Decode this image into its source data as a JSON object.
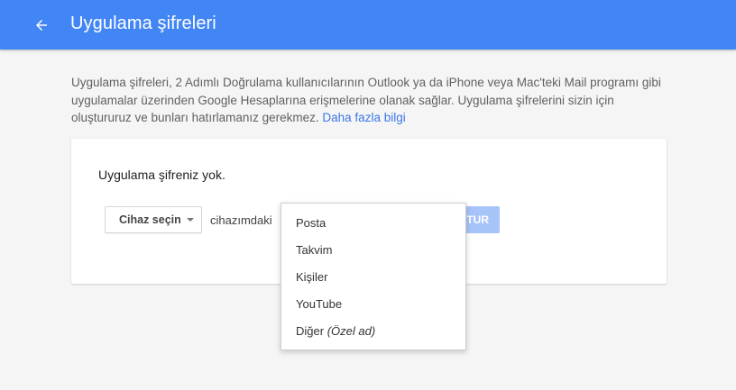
{
  "header": {
    "title": "Uygulama şifreleri",
    "back_icon": "arrow-back-icon",
    "color": "#4285f4"
  },
  "intro": {
    "text": "Uygulama şifreleri, 2 Adımlı Doğrulama kullanıcılarının Outlook ya da iPhone veya Mac'teki Mail programı gibi uygulamalar üzerinden Google Hesaplarına erişmelerine olanak sağlar. Uygulama şifrelerini sizin için oluştururuz ve bunları hatırlamanız gerekmez.",
    "link_text": "Daha fazla bilgi",
    "link_color": "#3b78e7"
  },
  "card": {
    "empty_text": "Uygulama şifreniz yok.",
    "device_select_label": "Cihaz seçin",
    "suffix_text": "cihazımdaki",
    "generate_label": "TUR"
  },
  "menu": {
    "items": [
      {
        "label": "Posta"
      },
      {
        "label": "Takvim"
      },
      {
        "label": "Kişiler"
      },
      {
        "label": "YouTube"
      },
      {
        "label": "Diğer",
        "note": "(Özel ad)"
      }
    ]
  }
}
